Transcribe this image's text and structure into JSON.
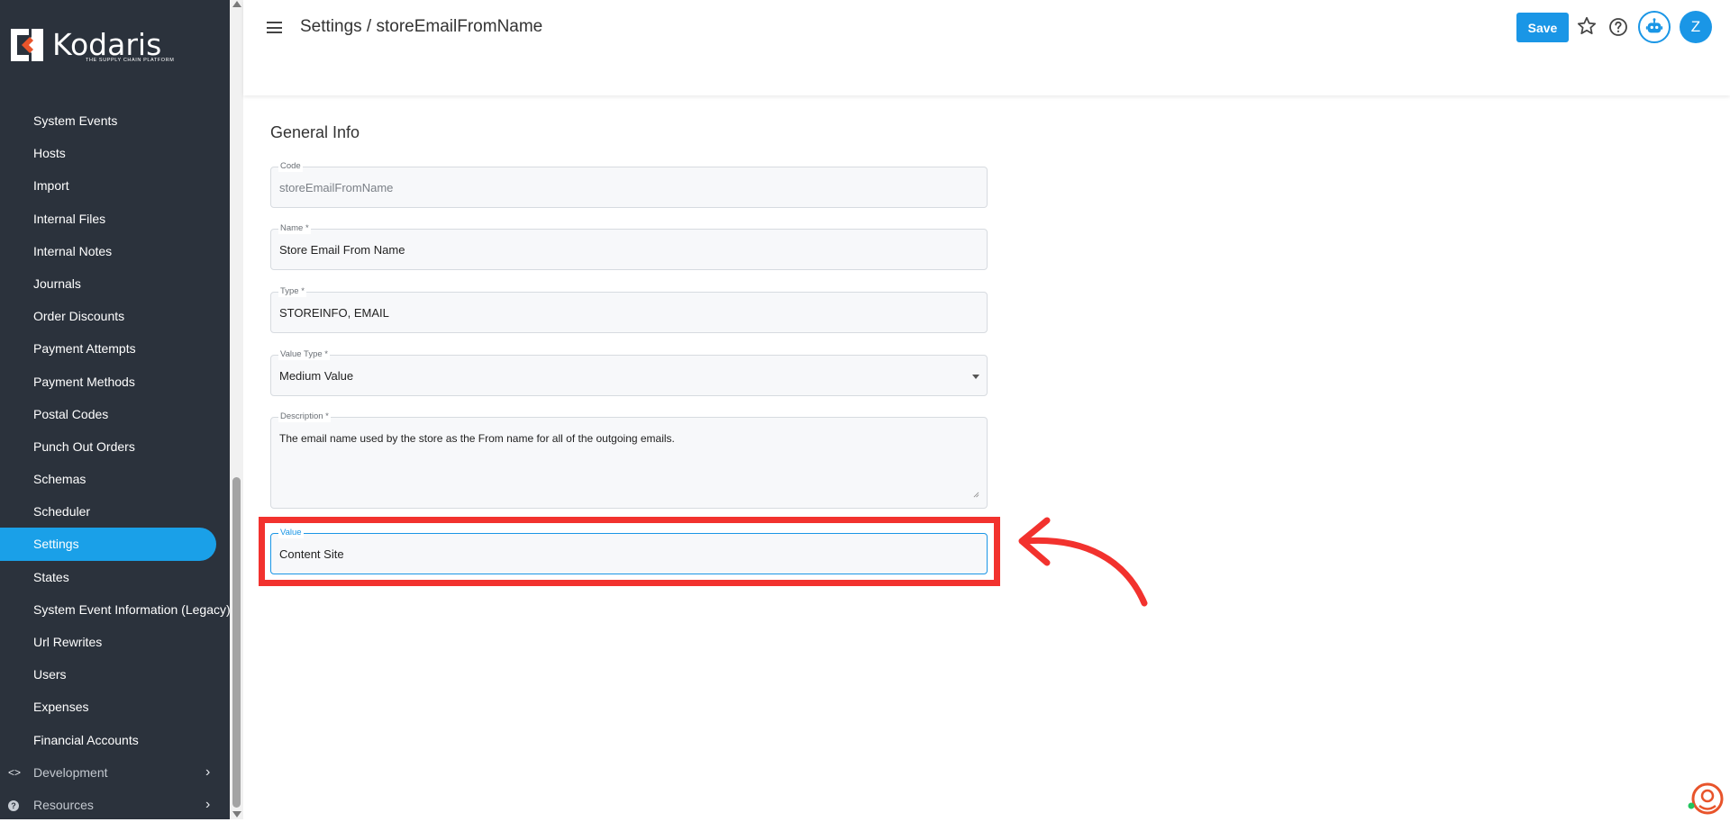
{
  "brand": {
    "name": "Kodaris",
    "tagline": "THE SUPPLY CHAIN PLATFORM",
    "accent": "#1a96e6",
    "logo_mark_color": "#e8542b"
  },
  "sidebar": {
    "items": [
      {
        "label": "System Events"
      },
      {
        "label": "Hosts"
      },
      {
        "label": "Import"
      },
      {
        "label": "Internal Files"
      },
      {
        "label": "Internal Notes"
      },
      {
        "label": "Journals"
      },
      {
        "label": "Order Discounts"
      },
      {
        "label": "Payment Attempts"
      },
      {
        "label": "Payment Methods"
      },
      {
        "label": "Postal Codes"
      },
      {
        "label": "Punch Out Orders"
      },
      {
        "label": "Schemas"
      },
      {
        "label": "Scheduler"
      },
      {
        "label": "Settings",
        "active": true
      },
      {
        "label": "States"
      },
      {
        "label": "System Event Information (Legacy)"
      },
      {
        "label": "Url Rewrites"
      },
      {
        "label": "Users"
      },
      {
        "label": "Expenses"
      },
      {
        "label": "Financial Accounts"
      }
    ],
    "groups": [
      {
        "label": "Development",
        "icon": "code-icon",
        "icon_glyph": "<>",
        "chevron": "›"
      },
      {
        "label": "Resources",
        "icon": "help-circle-icon",
        "icon_glyph": "?",
        "chevron": "›"
      }
    ]
  },
  "header": {
    "title": "Settings / storeEmailFromName",
    "save_label": "Save",
    "avatar_initial": "Z",
    "icons": [
      "menu-icon",
      "star-icon",
      "help-icon",
      "bot-icon"
    ]
  },
  "form": {
    "section_title": "General Info",
    "code": {
      "label": "Code",
      "value": "storeEmailFromName"
    },
    "name": {
      "label": "Name *",
      "value": "Store Email From Name"
    },
    "type": {
      "label": "Type *",
      "value": "STOREINFO, EMAIL"
    },
    "value_type": {
      "label": "Value Type *",
      "value": "Medium Value"
    },
    "description": {
      "label": "Description *",
      "value": "The email name used by the store as the From name for all of the outgoing emails."
    },
    "value": {
      "label": "Value",
      "value": "Content Site"
    }
  },
  "annotation": {
    "highlight_color": "#f2322e"
  }
}
